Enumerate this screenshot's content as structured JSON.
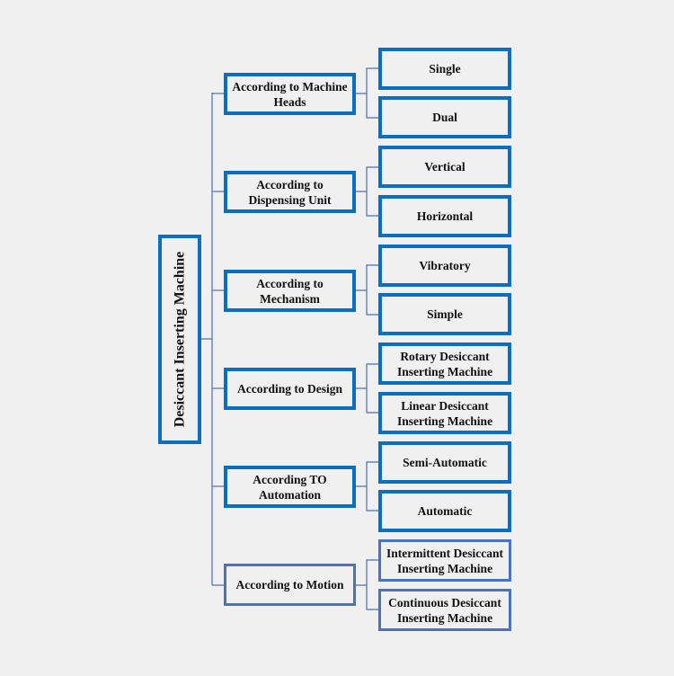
{
  "root": {
    "label": "Desiccant Inserting Machine"
  },
  "categories": [
    {
      "label": "According to Machine Heads",
      "children": [
        "Single",
        "Dual"
      ]
    },
    {
      "label": "According to Dispensing Unit",
      "children": [
        "Vertical",
        "Horizontal"
      ]
    },
    {
      "label": "According to Mechanism",
      "children": [
        "Vibratory",
        "Simple"
      ]
    },
    {
      "label": "According to Design",
      "children": [
        "Rotary Desiccant Inserting Machine",
        "Linear Desiccant Inserting Machine"
      ]
    },
    {
      "label": "According TO Automation",
      "children": [
        "Semi-Automatic",
        "Automatic"
      ]
    },
    {
      "label": "According to Motion",
      "children": [
        "Intermittent Desiccant Inserting Machine",
        "Continuous Desiccant Inserting Machine"
      ]
    }
  ],
  "colors": {
    "primary_border": "#0b6fc1",
    "secondary_border": "#4a72c2",
    "connector": "#4b6fb5",
    "background": "#f0f0f0"
  }
}
